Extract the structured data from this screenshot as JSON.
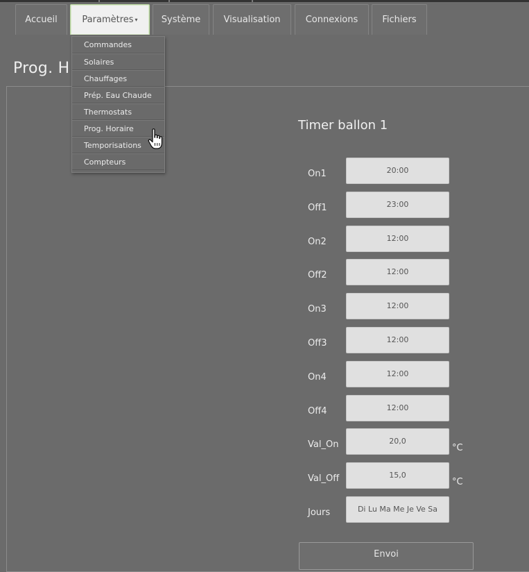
{
  "nav": {
    "tabs": [
      "Accueil",
      "Paramètres",
      "Système",
      "Visualisation",
      "Connexions",
      "Fichiers"
    ],
    "active_tab": "Paramètres"
  },
  "menu": {
    "items": [
      "Commandes",
      "Solaires",
      "Chauffages",
      "Prép. Eau Chaude",
      "Thermostats",
      "Prog. Horaire",
      "Temporisations",
      "Compteurs"
    ],
    "hovered_item": "Prog. Horaire"
  },
  "page": {
    "title": "Prog. H"
  },
  "form": {
    "title": "Timer ballon 1",
    "fields": [
      {
        "label": "On1",
        "value": "20:00",
        "unit": ""
      },
      {
        "label": "Off1",
        "value": "23:00",
        "unit": ""
      },
      {
        "label": "On2",
        "value": "12:00",
        "unit": ""
      },
      {
        "label": "Off2",
        "value": "12:00",
        "unit": ""
      },
      {
        "label": "On3",
        "value": "12:00",
        "unit": ""
      },
      {
        "label": "Off3",
        "value": "12:00",
        "unit": ""
      },
      {
        "label": "On4",
        "value": "12:00",
        "unit": ""
      },
      {
        "label": "Off4",
        "value": "12:00",
        "unit": ""
      },
      {
        "label": "Val_On",
        "value": "20,0",
        "unit": "°C"
      },
      {
        "label": "Val_Off",
        "value": "15,0",
        "unit": "°C"
      },
      {
        "label": "Jours",
        "value": "Di Lu Ma Me Je Ve Sa",
        "unit": ""
      }
    ],
    "submit_label": "Envoi"
  },
  "icons": {
    "cursor": "hand-pointer-icon",
    "menu_caret": "caret-down-icon"
  }
}
